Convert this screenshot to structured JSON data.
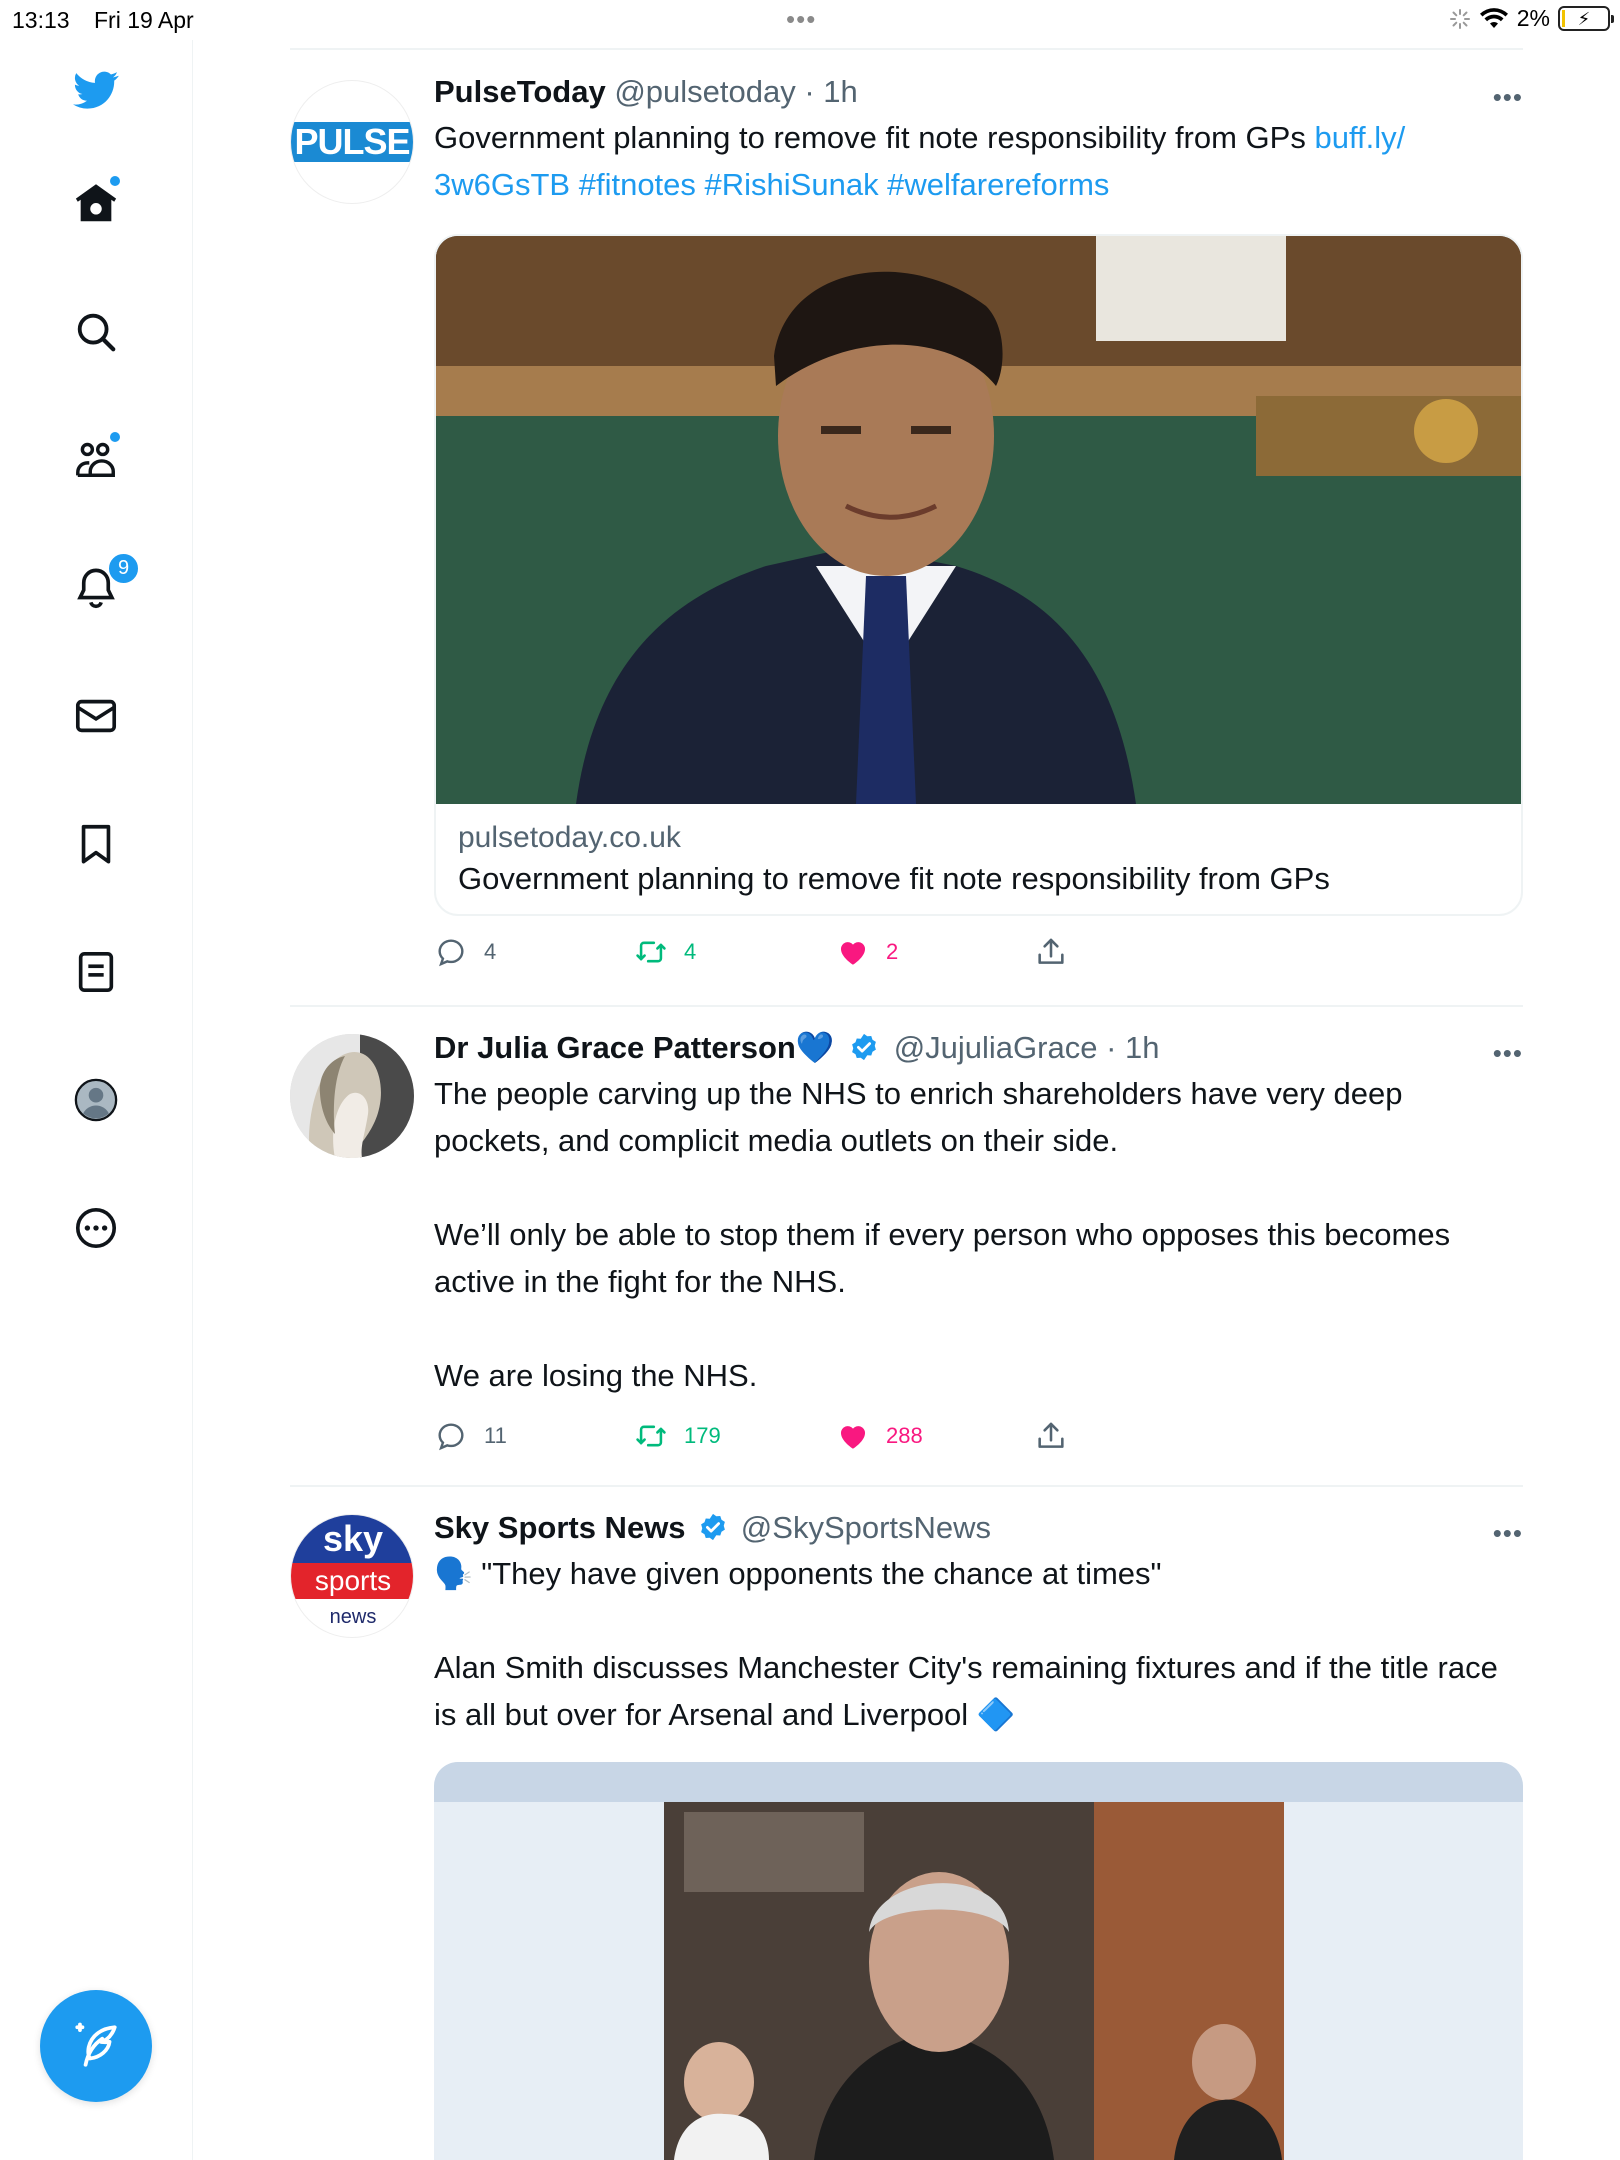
{
  "status": {
    "time": "13:13",
    "date": "Fri 19 Apr",
    "battery": "2%"
  },
  "sidebar": {
    "notifications_badge": "9"
  },
  "tweets": [
    {
      "name": "PulseToday",
      "handle": "@pulsetoday",
      "time": "· 1h",
      "avatar_text": "PULSE",
      "text": "Government planning to remove fit note responsibility from GPs ",
      "link": "buff.ly/\n3w6GsTB",
      "hashtags": " #fitnotes #RishiSunak #welfarereforms",
      "card": {
        "domain": "pulsetoday.co.uk",
        "title": "Government planning to remove fit note responsibility from GPs"
      },
      "replies": "4",
      "retweets": "4",
      "likes": "2"
    },
    {
      "name": "Dr Julia Grace Patterson",
      "emoji": "💙",
      "handle": "@JujuliaGrace",
      "time": "· 1h",
      "text": "The people carving up the NHS to enrich shareholders have very deep pockets, and complicit media outlets on their side.\n\nWe’ll only be able to stop them if every person who opposes this becomes active in the fight for the NHS.\n\nWe are losing the NHS.",
      "replies": "11",
      "retweets": "179",
      "likes": "288"
    },
    {
      "name": "Sky Sports News",
      "handle": "@SkySportsNews",
      "avatar_top": "sky",
      "avatar_mid": "sports",
      "avatar_bottom": "news",
      "emoji": "🗣️",
      "quote": " \"They have given opponents the chance at times\"",
      "text": "Alan Smith discusses Manchester City's remaining fixtures and if the title race is all but over for Arsenal and Liverpool ",
      "trail_emoji": "🔷"
    }
  ],
  "colors": {
    "accent": "#1d9bf0",
    "retweet": "#00ba7c",
    "like": "#f91880",
    "muted": "#536471"
  }
}
